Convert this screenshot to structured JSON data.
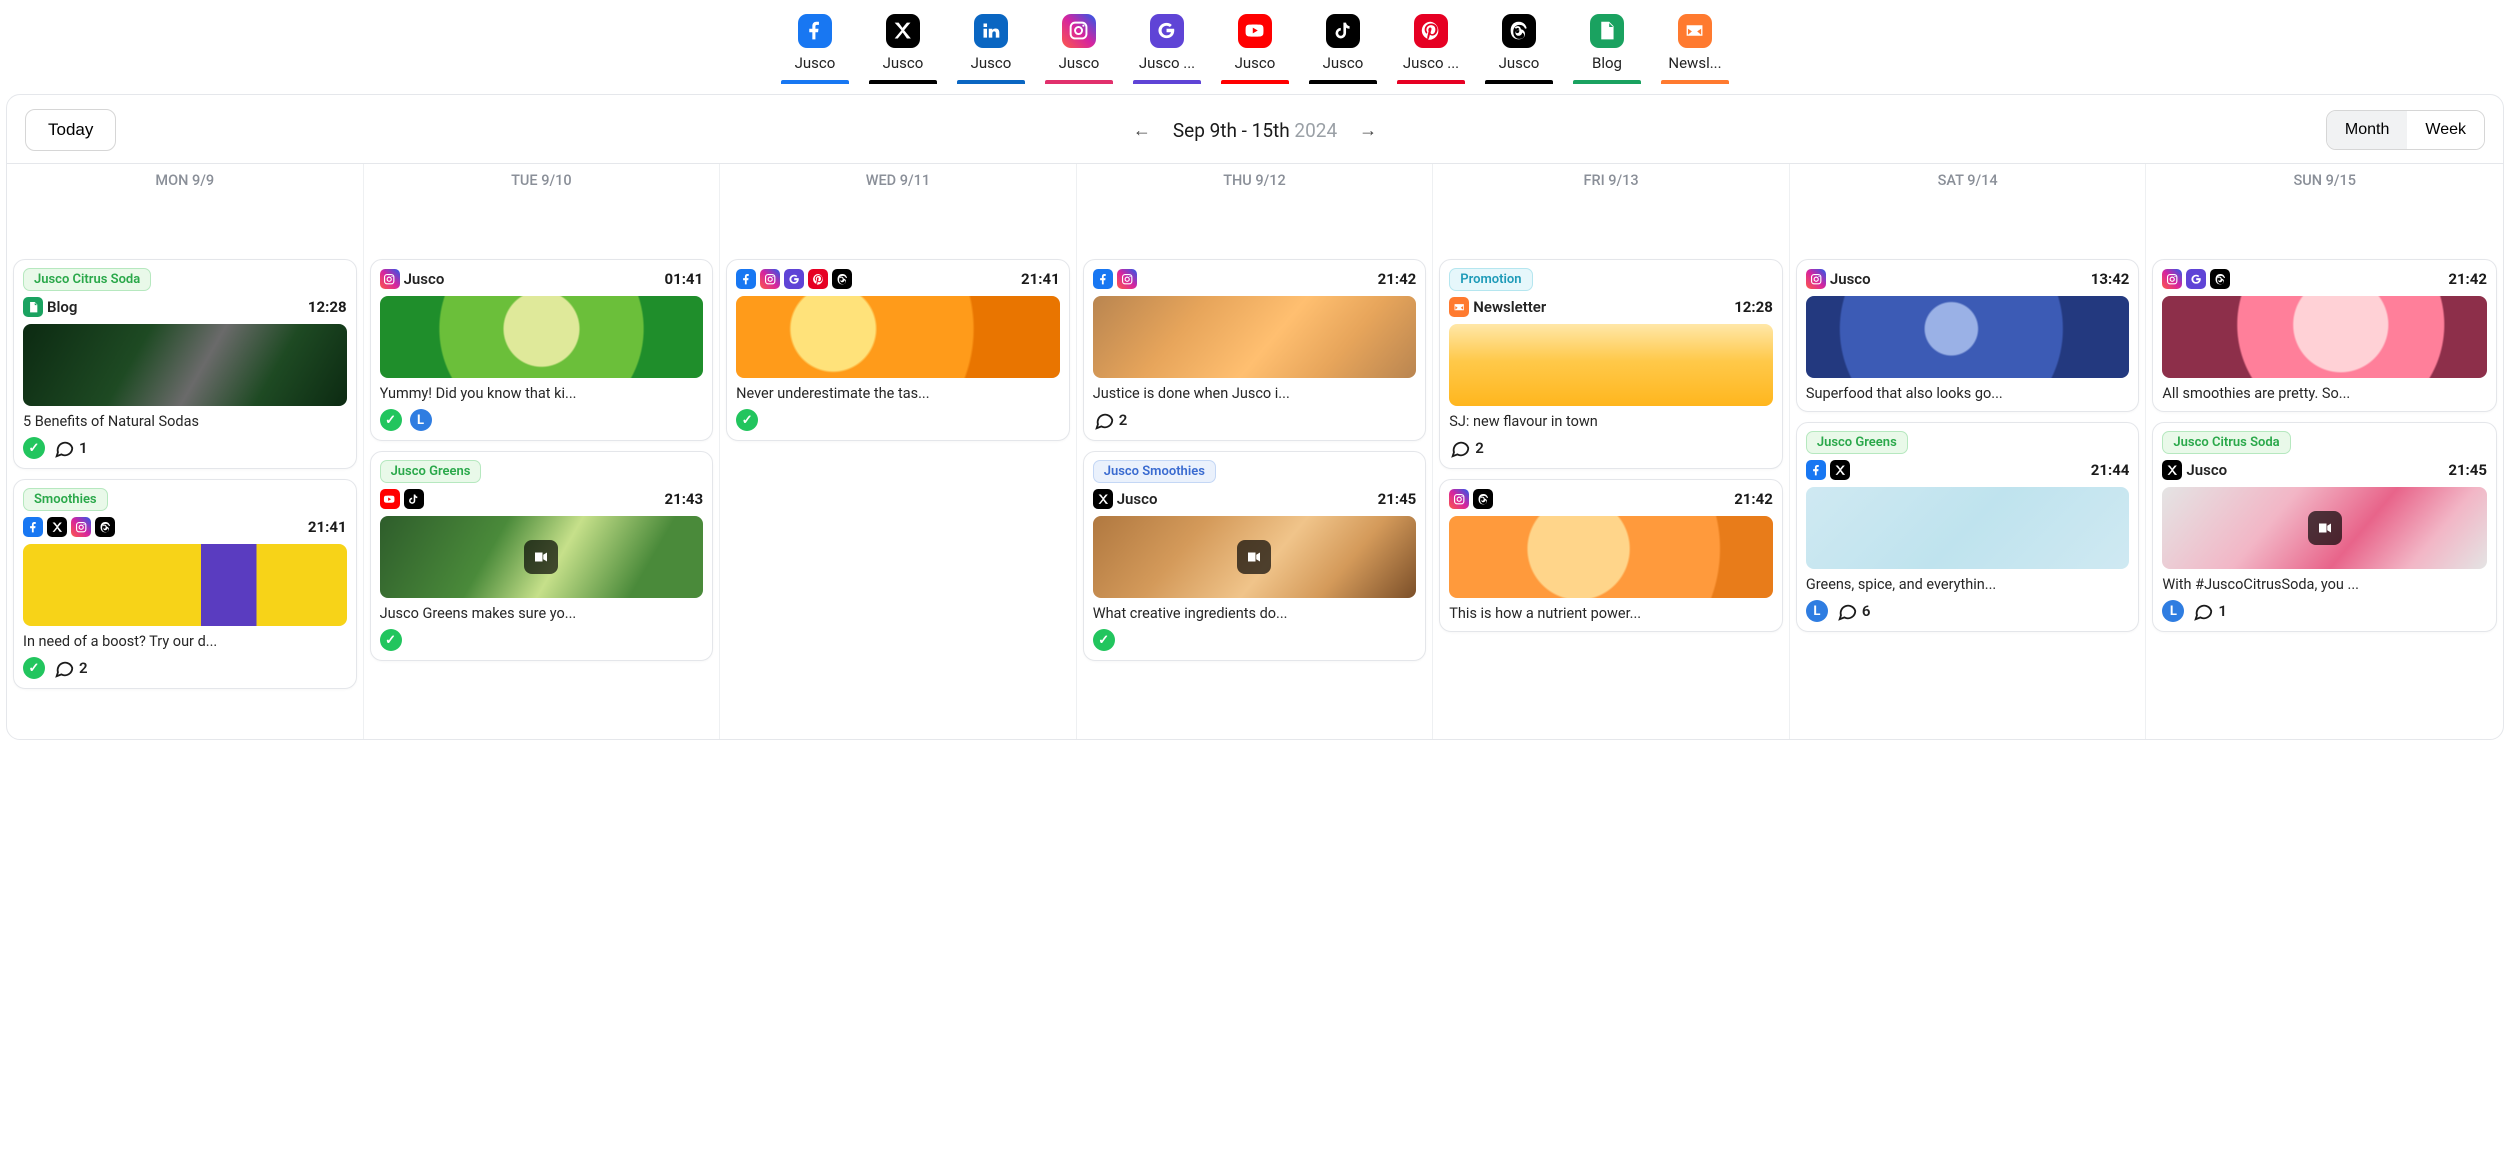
{
  "channels": [
    {
      "key": "facebook",
      "label": "Jusco",
      "underline": "#1877f2"
    },
    {
      "key": "x",
      "label": "Jusco",
      "underline": "#000000"
    },
    {
      "key": "linkedin",
      "label": "Jusco",
      "underline": "#0a66c2"
    },
    {
      "key": "instagram",
      "label": "Jusco",
      "underline": "#e1306c"
    },
    {
      "key": "google",
      "label": "Jusco ...",
      "underline": "#5f44d6"
    },
    {
      "key": "youtube",
      "label": "Jusco",
      "underline": "#ff0000"
    },
    {
      "key": "tiktok",
      "label": "Jusco",
      "underline": "#000000"
    },
    {
      "key": "pinterest",
      "label": "Jusco ...",
      "underline": "#e60023"
    },
    {
      "key": "threads",
      "label": "Jusco",
      "underline": "#000000"
    },
    {
      "key": "blog",
      "label": "Blog",
      "underline": "#1aa260"
    },
    {
      "key": "newsletter",
      "label": "Newsl...",
      "underline": "#ff7a2f"
    }
  ],
  "header": {
    "today": "Today",
    "range_main": "Sep 9th - 15th",
    "range_year": "2024",
    "month": "Month",
    "week": "Week"
  },
  "days": [
    "MON 9/9",
    "TUE 9/10",
    "WED 9/11",
    "THU 9/12",
    "FRI 9/13",
    "SAT 9/14",
    "SUN 9/15"
  ],
  "tags": {
    "citrus": {
      "text": "Jusco Citrus Soda",
      "bg": "#e9f9e9",
      "fg": "#2aa84a",
      "border": "#b6e8bf"
    },
    "smoothies_general": {
      "text": "Smoothies",
      "bg": "#e9f9e9",
      "fg": "#2aa84a",
      "border": "#b6e8bf"
    },
    "greens": {
      "text": "Jusco Greens",
      "bg": "#e9f9e9",
      "fg": "#2aa84a",
      "border": "#b6e8bf"
    },
    "promotion": {
      "text": "Promotion",
      "bg": "#e6f7fb",
      "fg": "#1f9bb8",
      "border": "#b5e6ef"
    },
    "jusco_smoothies": {
      "text": "Jusco Smoothies",
      "bg": "#eaf1fc",
      "fg": "#3a6bd0",
      "border": "#c4d7f5"
    }
  },
  "thumbs": {
    "detox": "linear-gradient(120deg,#0c2a12 0%,#1e4a23 35%,#6a6a6a 55%,#1e4a23 75%,#0c2a12 100%)",
    "kiwi": "radial-gradient(circle at 50% 40%,#dfe99a 0 22%,#6bbf3a 23% 60%,#1f8e2b 61% 100%)",
    "oranges": "radial-gradient(circle at 30% 40%,#ffe27a 0 18%,#ff9b1a 19% 60%,#e97500 61% 100%)",
    "citrus_board": "linear-gradient(130deg,#b98550 0%,#e7a55b 30%,#ffbf70 55%,#e7a55b 75%,#b98550 100%)",
    "yellow_bottle": "linear-gradient(90deg,#f7d318 0 55%,#5a3cc0 55% 72%,#f7d318 72% 100%)",
    "avocado": "linear-gradient(120deg,#2e5d2b 0%,#4a8a3a 35%,#c6e08a 55%,#4a8a3a 80%)",
    "smoothie_cups": "linear-gradient(130deg,#b07840 0%,#d49a5a 30%,#f0c48a 55%,#d49a5a 75%,#7b4f29 100%)",
    "orange_juice": "linear-gradient(180deg,#ffe7a8 0%,#ffc94a 45%,#ffb61e 100%)",
    "peaches": "radial-gradient(circle at 40% 40%,#ffd58a 0 25%,#ff9a3c 26% 70%,#e87c1a 71% 100%)",
    "blueberries": "radial-gradient(circle at 45% 40%,#9ab1e6 0 14%,#3c5bb5 15% 60%,#23397f 61% 100%)",
    "limes_blue": "linear-gradient(135deg,#cfe9f2 0%,#bfe3ee 50%,#cfe9f2 100%)",
    "pink_top": "radial-gradient(circle at 55% 35%,#ffd1d6 0 25%,#ff7f9a 26% 55%,#8d2f4a 56% 100%)",
    "pink_drink": "linear-gradient(130deg,#e4e4e4 0%,#f2b6c6 35%,#e8648a 60%,#f2b6c6 80%,#e4e4e4 100%)"
  },
  "columns": [
    {
      "posts": [
        {
          "tag": "citrus",
          "channelIcons": [
            "blog"
          ],
          "metaLabel": "Blog",
          "time": "12:28",
          "thumb": "detox",
          "caption": "5 Benefits of Natural Sodas",
          "status": [
            "green"
          ],
          "comments": "1"
        },
        {
          "tag": "smoothies_general",
          "channelIcons": [
            "facebook",
            "x",
            "instagram",
            "threads"
          ],
          "metaLabel": "",
          "time": "21:41",
          "thumb": "yellow_bottle",
          "caption": "In need of a boost? Try our d...",
          "status": [
            "green"
          ],
          "comments": "2"
        }
      ]
    },
    {
      "posts": [
        {
          "channelIcons": [
            "instagram"
          ],
          "metaLabel": "Jusco",
          "time": "01:41",
          "thumb": "kiwi",
          "caption": "Yummy! Did you know that ki...",
          "status": [
            "green",
            "blue"
          ]
        },
        {
          "tag": "greens",
          "channelIcons": [
            "youtube",
            "tiktok"
          ],
          "metaLabel": "",
          "time": "21:43",
          "thumb": "avocado",
          "video": true,
          "caption": "Jusco Greens makes sure yo...",
          "status": [
            "green"
          ]
        }
      ]
    },
    {
      "posts": [
        {
          "channelIcons": [
            "facebook",
            "instagram",
            "google",
            "pinterest",
            "threads"
          ],
          "metaLabel": "",
          "time": "21:41",
          "thumb": "oranges",
          "caption": "Never underestimate the tas...",
          "status": [
            "green"
          ]
        }
      ]
    },
    {
      "posts": [
        {
          "channelIcons": [
            "facebook",
            "instagram"
          ],
          "metaLabel": "",
          "time": "21:42",
          "thumb": "citrus_board",
          "caption": "Justice is done when Jusco i...",
          "comments": "2"
        },
        {
          "tag": "jusco_smoothies",
          "channelIcons": [
            "x"
          ],
          "metaLabel": "Jusco",
          "time": "21:45",
          "thumb": "smoothie_cups",
          "video": true,
          "caption": "What creative ingredients do...",
          "status": [
            "green"
          ]
        }
      ]
    },
    {
      "posts": [
        {
          "tag": "promotion",
          "channelIcons": [
            "newsletter"
          ],
          "metaLabel": "Newsletter",
          "time": "12:28",
          "thumb": "orange_juice",
          "caption": "SJ: new flavour in town",
          "comments": "2"
        },
        {
          "channelIcons": [
            "instagram",
            "threads"
          ],
          "metaLabel": "",
          "time": "21:42",
          "thumb": "peaches",
          "caption": "This is how a nutrient power..."
        }
      ]
    },
    {
      "posts": [
        {
          "channelIcons": [
            "instagram"
          ],
          "metaLabel": "Jusco",
          "time": "13:42",
          "thumb": "blueberries",
          "caption": "Superfood that also looks go..."
        },
        {
          "tag": "greens",
          "channelIcons": [
            "facebook",
            "x"
          ],
          "metaLabel": "",
          "time": "21:44",
          "thumb": "limes_blue",
          "caption": "Greens, spice, and everythin...",
          "status": [
            "blue"
          ],
          "comments": "6"
        }
      ]
    },
    {
      "posts": [
        {
          "channelIcons": [
            "instagram",
            "google",
            "threads"
          ],
          "metaLabel": "",
          "time": "21:42",
          "thumb": "pink_top",
          "caption": "All smoothies are pretty. So..."
        },
        {
          "tag": "citrus",
          "channelIcons": [
            "x"
          ],
          "metaLabel": "Jusco",
          "time": "21:45",
          "thumb": "pink_drink",
          "video": true,
          "caption": "With #JuscoCitrusSoda, you ...",
          "status": [
            "blue"
          ],
          "comments": "1"
        }
      ]
    }
  ]
}
